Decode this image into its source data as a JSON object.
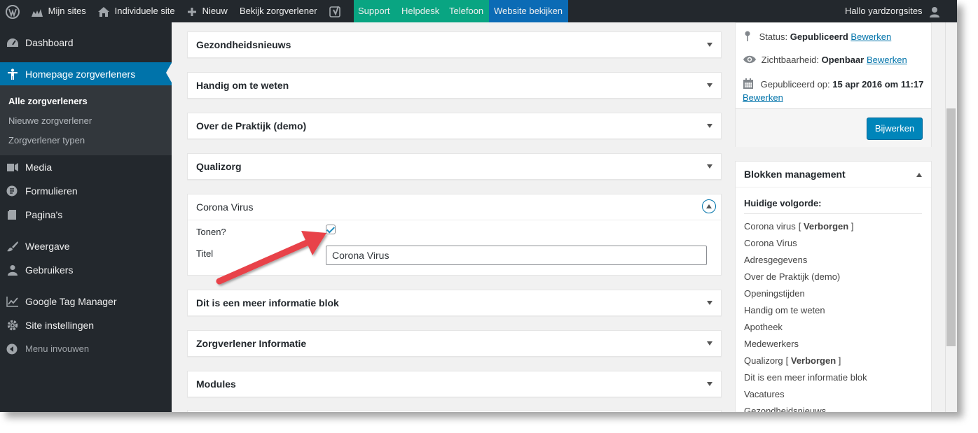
{
  "adminbar": {
    "my_sites": "Mijn sites",
    "site": "Individuele site",
    "new": "Nieuw",
    "view": "Bekijk zorgverlener",
    "support": "Support",
    "helpdesk": "Helpdesk",
    "phone": "Telefoon",
    "website": "Website bekijken",
    "greeting": "Hallo yardzorgsites"
  },
  "sidebar": {
    "dashboard": "Dashboard",
    "homepage": "Homepage zorgverleners",
    "sub_all": "Alle zorgverleners",
    "sub_new": "Nieuwe zorgverlener",
    "sub_types": "Zorgverlener typen",
    "media": "Media",
    "forms": "Formulieren",
    "pages": "Pagina's",
    "appearance": "Weergave",
    "users": "Gebruikers",
    "gtm": "Google Tag Manager",
    "site_settings": "Site instellingen",
    "collapse": "Menu invouwen"
  },
  "boxes": [
    "Gezondheidsnieuws",
    "Handig om te weten",
    "Over de Praktijk (demo)",
    "Qualizorg",
    "Dit is een meer informatie blok",
    "Zorgverlener Informatie",
    "Modules"
  ],
  "open_box": {
    "title": "Corona Virus",
    "show_label": "Tonen?",
    "title_label": "Titel",
    "title_value": "Corona Virus"
  },
  "publish": {
    "status_label": "Status:",
    "status_value": "Gepubliceerd",
    "edit": "Bewerken",
    "visibility_label": "Zichtbaarheid:",
    "visibility_value": "Openbaar",
    "published_label": "Gepubliceerd op:",
    "published_value": "15 apr 2016 om 11:17",
    "update": "Bijwerken"
  },
  "blocks": {
    "title": "Blokken management",
    "current_order": "Huidige volgorde:",
    "items": [
      {
        "name": "Corona virus",
        "tag": "Verborgen"
      },
      {
        "name": "Corona Virus",
        "tag": ""
      },
      {
        "name": "Adresgegevens",
        "tag": ""
      },
      {
        "name": "Over de Praktijk (demo)",
        "tag": ""
      },
      {
        "name": "Openingstijden",
        "tag": ""
      },
      {
        "name": "Handig om te weten",
        "tag": ""
      },
      {
        "name": "Apotheek",
        "tag": ""
      },
      {
        "name": "Medewerkers",
        "tag": ""
      },
      {
        "name": "Qualizorg",
        "tag": "Verborgen"
      },
      {
        "name": "Dit is een meer informatie blok",
        "tag": ""
      },
      {
        "name": "Vacatures",
        "tag": ""
      },
      {
        "name": "Gezondheidsnieuws",
        "tag": ""
      }
    ]
  },
  "colors": {
    "adminbar": "#23282d",
    "active": "#0073aa",
    "green": "#09a582",
    "arrow": "#e8424a"
  }
}
